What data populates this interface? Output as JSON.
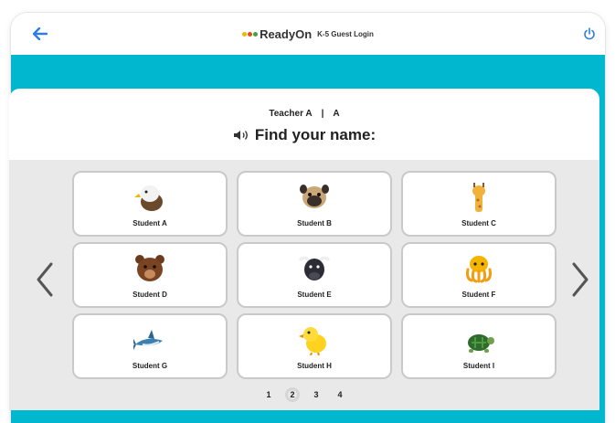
{
  "app": {
    "brand": "ReadyOn",
    "subtitle": "K-5 Guest Login",
    "logo_colors": [
      "#f4b400",
      "#e64a19",
      "#43a047"
    ]
  },
  "header": {
    "teacher": "Teacher A",
    "separator": "|",
    "class": "A",
    "prompt": "Find your name:"
  },
  "students": [
    {
      "label": "Student A",
      "icon": "eagle-icon"
    },
    {
      "label": "Student B",
      "icon": "pug-icon"
    },
    {
      "label": "Student C",
      "icon": "giraffe-icon"
    },
    {
      "label": "Student D",
      "icon": "bear-icon"
    },
    {
      "label": "Student E",
      "icon": "buffalo-icon"
    },
    {
      "label": "Student F",
      "icon": "octopus-icon"
    },
    {
      "label": "Student G",
      "icon": "shark-icon"
    },
    {
      "label": "Student H",
      "icon": "chick-icon"
    },
    {
      "label": "Student I",
      "icon": "turtle-icon"
    }
  ],
  "pagination": {
    "pages": [
      "1",
      "2",
      "3",
      "4"
    ],
    "current": "2"
  },
  "colors": {
    "accent": "#00b7d0",
    "back_arrow": "#2f7de1",
    "power": "#2f7de1"
  }
}
